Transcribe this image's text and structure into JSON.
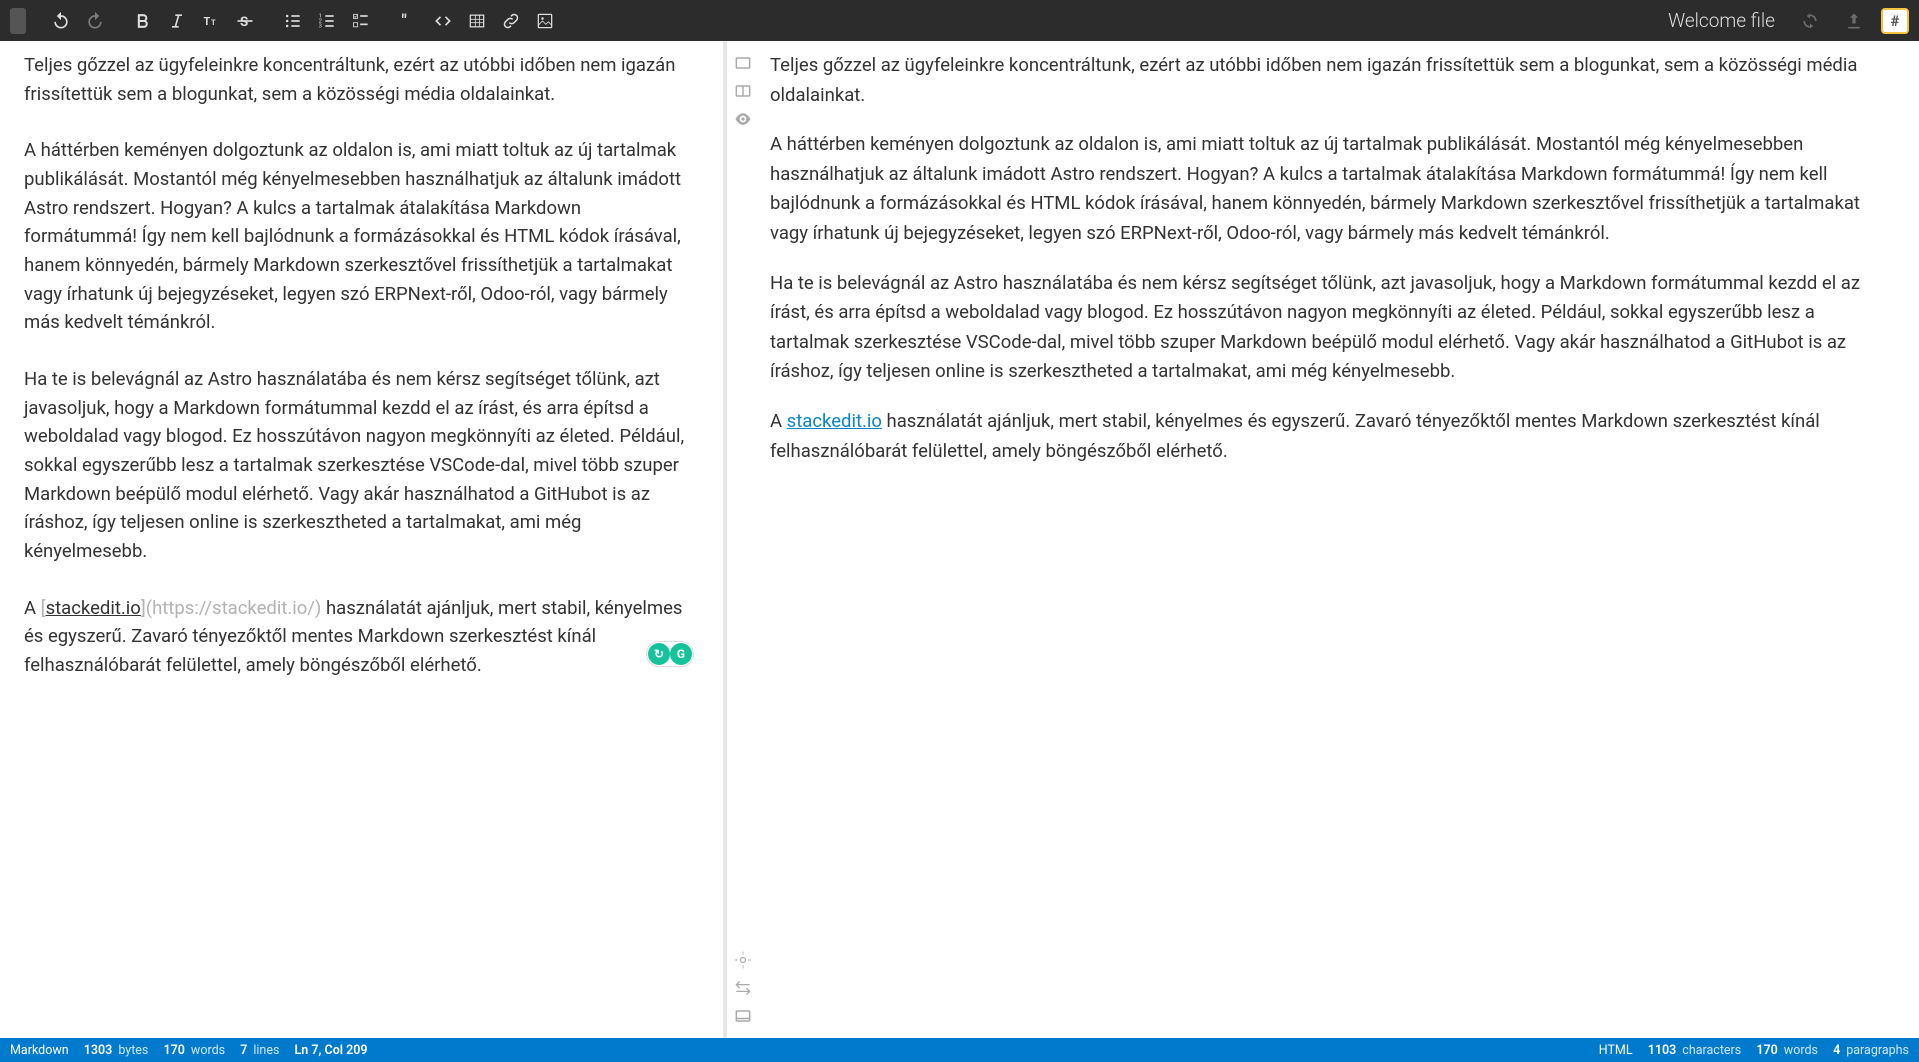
{
  "header": {
    "doc_title": "Welcome file"
  },
  "content": {
    "p1": "Teljes gőzzel az ügyfeleinkre koncentráltunk, ezért az utóbbi időben nem igazán frissítettük sem a blogunkat, sem a közösségi média oldalainkat.",
    "p2": "A háttérben keményen dolgoztunk az oldalon is, ami miatt toltuk az új tartalmak publikálását. Mostantól még kényelmesebben használhatjuk az általunk imádott Astro rendszert. Hogyan? A kulcs a tartalmak átalakítása Markdown formátummá! Így nem kell bajlódnunk a formázásokkal és HTML kódok írásával, hanem könnyedén, bármely Markdown szerkesztővel frissíthetjük a tartalmakat vagy írhatunk új bejegyzéseket, legyen szó ERPNext-ről, Odoo-ról, vagy bármely más kedvelt témánkról.",
    "p3": "Ha te is belevágnál az Astro használatába és nem kérsz segítséget tőlünk, azt javasoljuk, hogy a Markdown formátummal kezdd el az írást, és arra építsd a weboldalad vagy blogod. Ez hosszútávon nagyon megkönnyíti az életed. Például, sokkal egyszerűbb lesz a tartalmak szerkesztése VSCode-dal, mivel több szuper Markdown beépülő modul elérhető. Vagy akár használhatod a GitHubot is az íráshoz, így teljesen online is szerkesztheted a tartalmakat, ami még kényelmesebb.",
    "p4_prefix_editor": "A ",
    "p4_link_text": "stackedit.io",
    "p4_link_url_md": "(https://stackedit.io/)",
    "p4_rest": " használatát ajánljuk, mert stabil, kényelmes és egyszerű. Zavaró tényezőktől mentes Markdown szerkesztést kínál felhasználóbarát felülettel, amely böngészőből elérhető."
  },
  "statusbar": {
    "left": {
      "mode": "Markdown",
      "bytes_val": "1303",
      "bytes_label": "bytes",
      "words_val": "170",
      "words_label": "words",
      "lines_val": "7",
      "lines_label": "lines",
      "cursor": "Ln 7, Col 209"
    },
    "right": {
      "mode": "HTML",
      "chars_val": "1103",
      "chars_label": "characters",
      "words_val": "170",
      "words_label": "words",
      "paras_val": "4",
      "paras_label": "paragraphs"
    }
  },
  "icons": {
    "logo_char": "#"
  }
}
